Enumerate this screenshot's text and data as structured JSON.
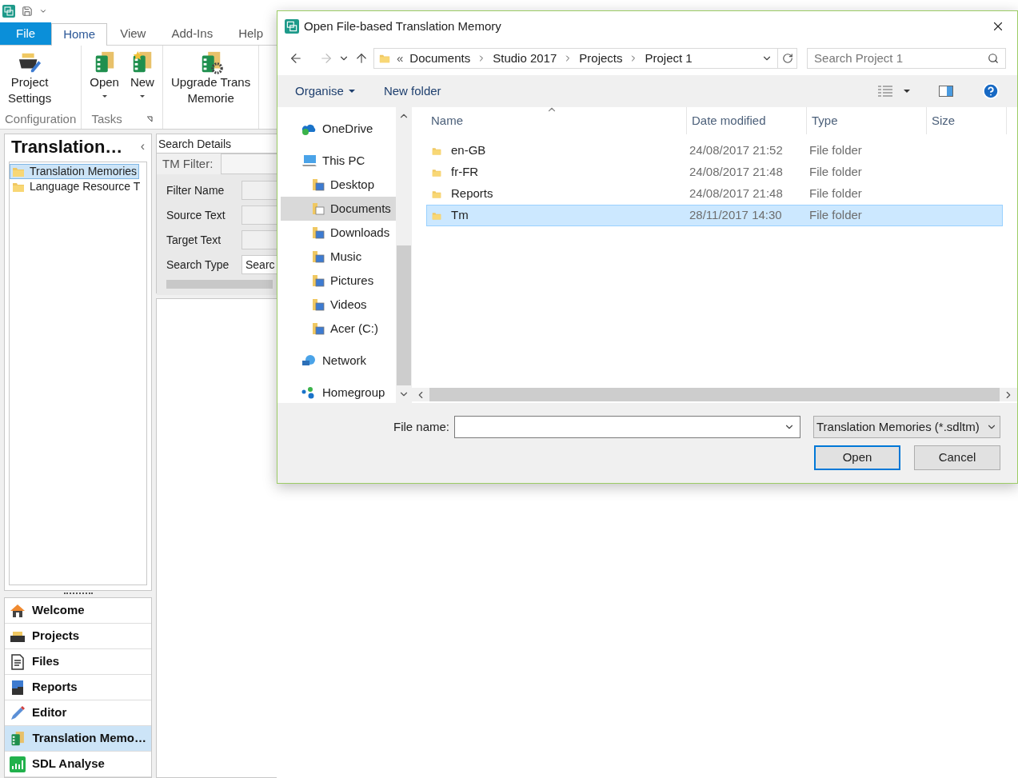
{
  "app": {
    "ribbon_tabs": [
      {
        "label": "File",
        "kind": "file",
        "selected": false
      },
      {
        "label": "Home",
        "kind": "tab",
        "selected": true
      },
      {
        "label": "View",
        "kind": "tab",
        "selected": false
      },
      {
        "label": "Add-Ins",
        "kind": "tab",
        "selected": false
      },
      {
        "label": "Help",
        "kind": "tab",
        "selected": false
      }
    ],
    "ribbon_groups": [
      {
        "label": "Configuration",
        "launcher": false,
        "buttons": [
          {
            "lines": [
              "Project",
              "Settings"
            ],
            "dropdown": false
          }
        ]
      },
      {
        "label": "Tasks",
        "launcher": true,
        "buttons": [
          {
            "lines": [
              "Open"
            ],
            "dropdown": true
          },
          {
            "lines": [
              "New"
            ],
            "dropdown": true
          }
        ]
      },
      {
        "buttons": [
          {
            "lines": [
              "Upgrade Trans",
              "Memorie"
            ],
            "dropdown": false
          }
        ]
      }
    ],
    "nav_panel": {
      "title": "Translation…",
      "collapse": "‹",
      "tree": [
        {
          "label": "Translation Memories",
          "selected": true
        },
        {
          "label": "Language Resource T",
          "selected": false
        }
      ],
      "sections": [
        {
          "label": "Welcome",
          "selected": false
        },
        {
          "label": "Projects",
          "selected": false
        },
        {
          "label": "Files",
          "selected": false
        },
        {
          "label": "Reports",
          "selected": false
        },
        {
          "label": "Editor",
          "selected": false
        },
        {
          "label": "Translation Memo…",
          "selected": true
        },
        {
          "label": "SDL Analyse",
          "selected": false
        }
      ]
    },
    "search_panel": {
      "title": "Search Details",
      "filter_label": "TM Filter:",
      "fields": [
        {
          "label": "Filter Name",
          "kind": "input"
        },
        {
          "label": "Source Text",
          "kind": "input"
        },
        {
          "label": "Target Text",
          "kind": "input"
        },
        {
          "label": "Search Type",
          "kind": "select",
          "value": "Searc"
        }
      ]
    }
  },
  "dialog": {
    "title": "Open File-based Translation Memory",
    "breadcrumb": [
      "Documents",
      "Studio 2017",
      "Projects",
      "Project 1"
    ],
    "overflow": "«",
    "search_placeholder": "Search Project 1",
    "toolbar": {
      "organise": "Organise",
      "new_folder": "New folder"
    },
    "nav": [
      {
        "label": "OneDrive",
        "selected": false
      },
      {
        "label": "This PC",
        "selected": false,
        "children": [
          {
            "label": "Desktop",
            "selected": false
          },
          {
            "label": "Documents",
            "selected": true
          },
          {
            "label": "Downloads",
            "selected": false
          },
          {
            "label": "Music",
            "selected": false
          },
          {
            "label": "Pictures",
            "selected": false
          },
          {
            "label": "Videos",
            "selected": false
          },
          {
            "label": "Acer (C:)",
            "selected": false
          }
        ]
      },
      {
        "label": "Network",
        "selected": false
      },
      {
        "label": "Homegroup",
        "selected": false
      }
    ],
    "columns": [
      "Name",
      "Date modified",
      "Type",
      "Size"
    ],
    "rows": [
      {
        "name": "en-GB",
        "date": "24/08/2017 21:52",
        "type": "File folder",
        "selected": false
      },
      {
        "name": "fr-FR",
        "date": "24/08/2017 21:48",
        "type": "File folder",
        "selected": false
      },
      {
        "name": "Reports",
        "date": "24/08/2017 21:48",
        "type": "File folder",
        "selected": false
      },
      {
        "name": "Tm",
        "date": "28/11/2017 14:30",
        "type": "File folder",
        "selected": true
      }
    ],
    "file_name_label": "File name:",
    "file_type": "Translation Memories (*.sdltm)",
    "buttons": [
      {
        "label": "Open",
        "kind": "primary"
      },
      {
        "label": "Cancel",
        "kind": "normal"
      }
    ]
  }
}
